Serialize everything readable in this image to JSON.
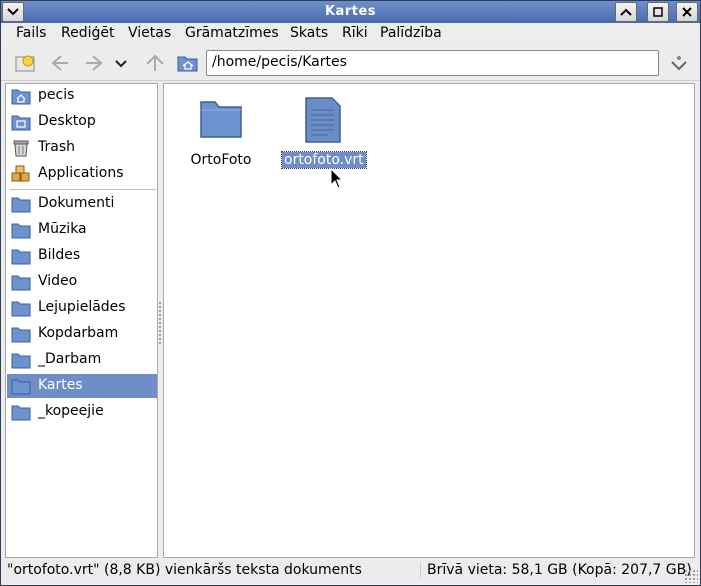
{
  "window": {
    "title": "Kartes"
  },
  "menubar": {
    "items": [
      "Fails",
      "Rediģēt",
      "Vietas",
      "Grāmatzīmes",
      "Skats",
      "Rīki",
      "Palīdzība"
    ]
  },
  "toolbar": {
    "location": "/home/pecis/Kartes"
  },
  "sidebar": {
    "places": [
      {
        "label": "pecis",
        "icon": "home-folder-icon"
      },
      {
        "label": "Desktop",
        "icon": "desktop-icon"
      },
      {
        "label": "Trash",
        "icon": "trash-icon"
      },
      {
        "label": "Applications",
        "icon": "applications-icon"
      }
    ],
    "bookmarks": [
      {
        "label": "Dokumenti",
        "icon": "folder-icon"
      },
      {
        "label": "Mūzika",
        "icon": "folder-icon"
      },
      {
        "label": "Bildes",
        "icon": "folder-icon"
      },
      {
        "label": "Video",
        "icon": "folder-icon"
      },
      {
        "label": "Lejupielādes",
        "icon": "folder-icon"
      },
      {
        "label": "Kopdarbam",
        "icon": "folder-icon"
      },
      {
        "label": "_Darbam",
        "icon": "folder-icon"
      },
      {
        "label": "Kartes",
        "icon": "folder-icon",
        "selected": true
      },
      {
        "label": "_kopeejie",
        "icon": "folder-icon"
      }
    ]
  },
  "files": [
    {
      "name": "OrtoFoto",
      "icon": "folder-icon",
      "selected": false
    },
    {
      "name": "ortofoto.vrt",
      "icon": "text-file-icon",
      "selected": true
    }
  ],
  "status": {
    "left": "\"ortofoto.vrt\" (8,8 KB) vienkāršs teksta dokuments",
    "right": "Brīvā vieta: 58,1 GB (Kopā: 207,7 GB)"
  },
  "colors": {
    "selection": "#6f8ec8",
    "titlebar": "#4a6cb0",
    "folder": "#6d93cf"
  }
}
